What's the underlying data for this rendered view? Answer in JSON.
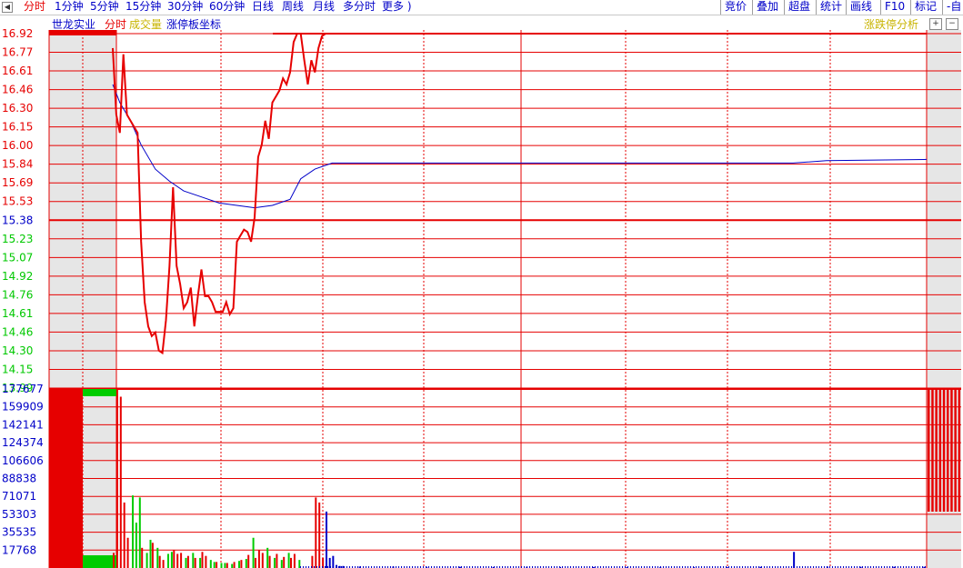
{
  "toolbar": {
    "items": [
      {
        "label": "分时",
        "active": true
      },
      {
        "label": "1分钟"
      },
      {
        "label": "5分钟"
      },
      {
        "label": "15分钟"
      },
      {
        "label": "30分钟"
      },
      {
        "label": "60分钟"
      },
      {
        "label": "日线"
      },
      {
        "label": "周线"
      },
      {
        "label": "月线"
      },
      {
        "label": "多分时"
      },
      {
        "label": "更多 )"
      }
    ],
    "right_items": [
      "竞价",
      "叠加",
      "超盘",
      "统计",
      "画线",
      "F10",
      "标记",
      "-自"
    ]
  },
  "legend": {
    "stock": "世龙实业",
    "mode": "分时",
    "volume": "成交量",
    "coord": "涨停板坐标",
    "right": "涨跌停分析"
  },
  "colors": {
    "up": "#e60000",
    "down": "#00cc00",
    "avg": "#0000c8",
    "grid": "#e60000",
    "vol_neutral": "#0000c8",
    "legend_yellow": "#c8b400",
    "sidebar": "#e6e6e6"
  },
  "icons": {
    "left_arrow": "left-arrow-icon",
    "plus": "plus-icon",
    "minus": "minus-icon"
  },
  "chart_data": {
    "type": "line",
    "price_ticks": [
      "16.92",
      "16.77",
      "16.61",
      "16.46",
      "16.30",
      "16.15",
      "16.00",
      "15.84",
      "15.69",
      "15.53",
      "15.38",
      "15.23",
      "15.07",
      "14.92",
      "14.76",
      "14.61",
      "14.46",
      "14.30",
      "14.15",
      "13.99"
    ],
    "ylim": [
      13.99,
      16.92
    ],
    "prev_close": 15.38,
    "volume_ticks": [
      "177677",
      "159909",
      "142141",
      "124374",
      "106606",
      "88838",
      "71071",
      "53303",
      "35535",
      "17768"
    ],
    "volume_max": 177677,
    "total_minutes": 240,
    "series": [
      {
        "key": "price",
        "points": [
          [
            0,
            16.8
          ],
          [
            1,
            16.25
          ],
          [
            2,
            16.1
          ],
          [
            3,
            16.75
          ],
          [
            4,
            16.25
          ],
          [
            6,
            16.15
          ],
          [
            7,
            16.1
          ],
          [
            8,
            15.2
          ],
          [
            9,
            14.7
          ],
          [
            10,
            14.5
          ],
          [
            11,
            14.42
          ],
          [
            12,
            14.45
          ],
          [
            13,
            14.3
          ],
          [
            14,
            14.28
          ],
          [
            15,
            14.55
          ],
          [
            16,
            15.0
          ],
          [
            17,
            15.65
          ],
          [
            18,
            15.0
          ],
          [
            19,
            14.85
          ],
          [
            20,
            14.65
          ],
          [
            21,
            14.7
          ],
          [
            22,
            14.82
          ],
          [
            23,
            14.5
          ],
          [
            24,
            14.75
          ],
          [
            25,
            14.97
          ],
          [
            26,
            14.75
          ],
          [
            27,
            14.75
          ],
          [
            28,
            14.7
          ],
          [
            29,
            14.62
          ],
          [
            30,
            14.62
          ],
          [
            31,
            14.62
          ],
          [
            32,
            14.7
          ],
          [
            33,
            14.6
          ],
          [
            34,
            14.65
          ],
          [
            35,
            15.2
          ],
          [
            36,
            15.25
          ],
          [
            37,
            15.3
          ],
          [
            38,
            15.28
          ],
          [
            39,
            15.2
          ],
          [
            40,
            15.4
          ],
          [
            41,
            15.9
          ],
          [
            42,
            16.0
          ],
          [
            43,
            16.2
          ],
          [
            44,
            16.05
          ],
          [
            45,
            16.35
          ],
          [
            46,
            16.4
          ],
          [
            47,
            16.45
          ],
          [
            48,
            16.55
          ],
          [
            49,
            16.5
          ],
          [
            50,
            16.6
          ],
          [
            51,
            16.85
          ],
          [
            52,
            16.92
          ],
          [
            53,
            16.92
          ],
          [
            54,
            16.7
          ],
          [
            55,
            16.5
          ],
          [
            56,
            16.7
          ],
          [
            57,
            16.6
          ],
          [
            58,
            16.8
          ],
          [
            59,
            16.9
          ],
          [
            60,
            16.92
          ]
        ]
      },
      {
        "key": "average",
        "points": [
          [
            0,
            16.5
          ],
          [
            2,
            16.35
          ],
          [
            5,
            16.2
          ],
          [
            8,
            16.0
          ],
          [
            12,
            15.8
          ],
          [
            16,
            15.7
          ],
          [
            20,
            15.62
          ],
          [
            25,
            15.57
          ],
          [
            30,
            15.52
          ],
          [
            35,
            15.5
          ],
          [
            40,
            15.48
          ],
          [
            45,
            15.5
          ],
          [
            50,
            15.55
          ],
          [
            53,
            15.72
          ],
          [
            57,
            15.8
          ],
          [
            62,
            15.85
          ],
          [
            72,
            15.85
          ],
          [
            120,
            15.85
          ],
          [
            160,
            15.85
          ],
          [
            200,
            15.85
          ],
          [
            210,
            15.87
          ],
          [
            240,
            15.88
          ]
        ]
      }
    ],
    "volume_up": [
      [
        0,
        15000
      ],
      [
        1,
        177677
      ],
      [
        2,
        170000
      ],
      [
        3,
        65000
      ],
      [
        4,
        30000
      ],
      [
        8,
        20000
      ],
      [
        11,
        25000
      ],
      [
        13,
        12000
      ],
      [
        14,
        8000
      ],
      [
        17,
        18000
      ],
      [
        18,
        14000
      ],
      [
        19,
        15000
      ],
      [
        21,
        12000
      ],
      [
        23,
        10000
      ],
      [
        25,
        16000
      ],
      [
        26,
        12000
      ],
      [
        29,
        6000
      ],
      [
        32,
        5000
      ],
      [
        34,
        6000
      ],
      [
        36,
        8000
      ],
      [
        38,
        13000
      ],
      [
        40,
        10000
      ],
      [
        41,
        18000
      ],
      [
        42,
        15000
      ],
      [
        44,
        12000
      ],
      [
        46,
        14000
      ],
      [
        48,
        11000
      ],
      [
        50,
        10000
      ],
      [
        51,
        14000
      ],
      [
        56,
        12000
      ],
      [
        57,
        70000
      ],
      [
        58,
        65000
      ],
      [
        59,
        10000
      ]
    ],
    "volume_down": [
      [
        5,
        72000
      ],
      [
        6,
        45000
      ],
      [
        7,
        70000
      ],
      [
        9,
        15000
      ],
      [
        10,
        28000
      ],
      [
        12,
        20000
      ],
      [
        15,
        14000
      ],
      [
        16,
        16000
      ],
      [
        20,
        10000
      ],
      [
        22,
        15000
      ],
      [
        24,
        10000
      ],
      [
        27,
        8000
      ],
      [
        28,
        6000
      ],
      [
        30,
        5000
      ],
      [
        31,
        5000
      ],
      [
        33,
        4000
      ],
      [
        35,
        7000
      ],
      [
        37,
        9000
      ],
      [
        39,
        30000
      ],
      [
        43,
        20000
      ],
      [
        45,
        10000
      ],
      [
        47,
        8000
      ],
      [
        49,
        15000
      ],
      [
        52,
        8000
      ]
    ],
    "volume_neutral": [
      [
        60,
        56000
      ],
      [
        61,
        10000
      ],
      [
        62,
        12000
      ],
      [
        63,
        3000
      ],
      [
        64,
        2000
      ],
      [
        65,
        2000
      ],
      [
        70,
        1500
      ],
      [
        80,
        1500
      ],
      [
        90,
        1200
      ],
      [
        100,
        1200
      ],
      [
        110,
        1000
      ],
      [
        120,
        1000
      ],
      [
        130,
        1000
      ],
      [
        140,
        1000
      ],
      [
        150,
        1000
      ],
      [
        160,
        1000
      ],
      [
        170,
        1000
      ],
      [
        180,
        1000
      ],
      [
        190,
        1200
      ],
      [
        200,
        16000
      ],
      [
        210,
        1500
      ],
      [
        220,
        1200
      ],
      [
        230,
        1200
      ],
      [
        239,
        1200
      ]
    ]
  }
}
